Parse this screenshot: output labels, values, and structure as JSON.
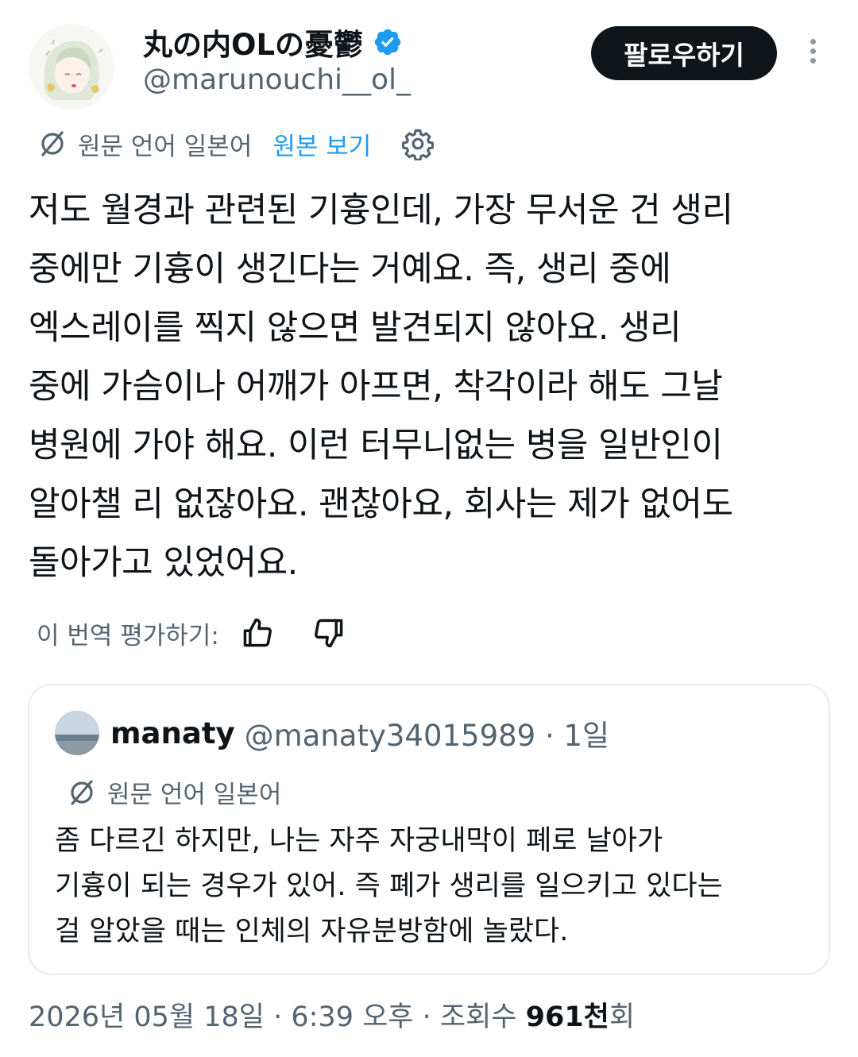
{
  "header": {
    "display_name": "丸の内OLの憂鬱",
    "handle": "@marunouchi__ol_",
    "follow_label": "팔로우하기"
  },
  "translation": {
    "source_language": "원문 언어 일본어",
    "show_original": "원본 보기"
  },
  "tweet": {
    "text": "저도 월경과 관련된 기흉인데, 가장 무서운 건 생리\n중에만 기흉이 생긴다는 거예요. 즉, 생리 중에\n엑스레이를 찍지 않으면 발견되지 않아요. 생리\n중에 가슴이나 어깨가 아프면, 착각이라 해도 그날\n병원에 가야 해요. 이런 터무니없는 병을 일반인이\n알아챌 리 없잖아요. 괜찮아요, 회사는 제가 없어도\n돌아가고 있었어요."
  },
  "rate": {
    "label": "이 번역 평가하기:"
  },
  "quote": {
    "name": "manaty",
    "handle_time": "@manaty34015989 · 1일",
    "source_language": "원문 언어 일본어",
    "text": "좀 다르긴 하지만, 나는 자주 자궁내막이 폐로 날아가\n기흉이 되는 경우가 있어. 즉 폐가 생리를 일으키고 있다는\n걸 알았을 때는 인체의 자유분방함에 놀랐다."
  },
  "meta": {
    "datetime": "2026년 05월 18일 · 6:39 오후 · 조회수 ",
    "views": "961천",
    "views_suffix": "회"
  },
  "colors": {
    "text": "#0f1419",
    "secondary": "#536471",
    "accent": "#1d9bf0",
    "border": "#e6ecf0"
  }
}
